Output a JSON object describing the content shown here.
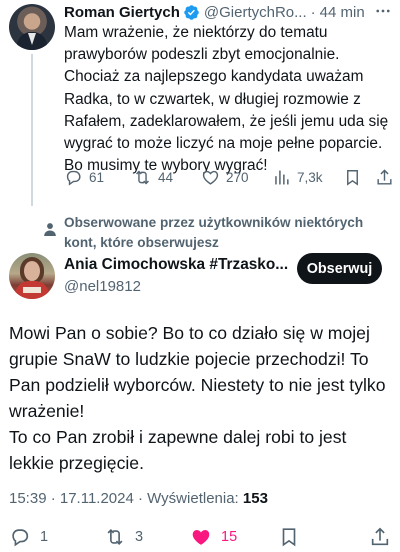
{
  "parent_tweet": {
    "name": "Roman Giertych",
    "handle": "@GiertychRo...",
    "separator": "·",
    "time": "44 min",
    "text": "Mam wrażenie, że niektórzy do tematu\nprawyborów podeszli zbyt emocjonalnie.\nChociaż za najlepszego kandydata uważam\nRadka, to w czwartek, w długiej rozmowie z\nRafałem, zadeklarowałem, że jeśli jemu uda się\nwygrać to może liczyć na moje pełne poparcie.\nBo musimy te wybory wygrać!",
    "replies": "61",
    "reposts": "44",
    "likes": "270",
    "views": "7,3k",
    "verified_color": "#1d9bf0"
  },
  "notice": {
    "text": "Obserwowane przez użytkowników niektórych\nkont, które obserwujesz"
  },
  "main_tweet": {
    "name": "Ania Cimochowska #Trzasko...",
    "handle": "@nel19812",
    "follow_label": "Obserwuj",
    "text": "Mowi Pan o sobie? Bo to co działo się w mojej\ngrupie SnaW to ludzkie pojecie przechodzi! To\nPan podzielił wyborców. Niestety to nie jest tylko\nwrażenie!\nTo co Pan zrobił i zapewne dalej robi to jest\nlekkie przegięcie.",
    "timestamp": "15:39 · 17.11.2024 · Wyświetlenia: ",
    "views": "153",
    "replies": "1",
    "reposts": "3",
    "likes": "15",
    "like_color": "#f91880"
  },
  "icons": {
    "verified": "verified-badge-icon",
    "more": "more-options-icon",
    "reply": "reply-icon",
    "repost": "repost-icon",
    "like": "heart-icon",
    "views": "views-chart-icon",
    "bookmark": "bookmark-icon",
    "share": "share-icon",
    "person": "person-icon"
  }
}
